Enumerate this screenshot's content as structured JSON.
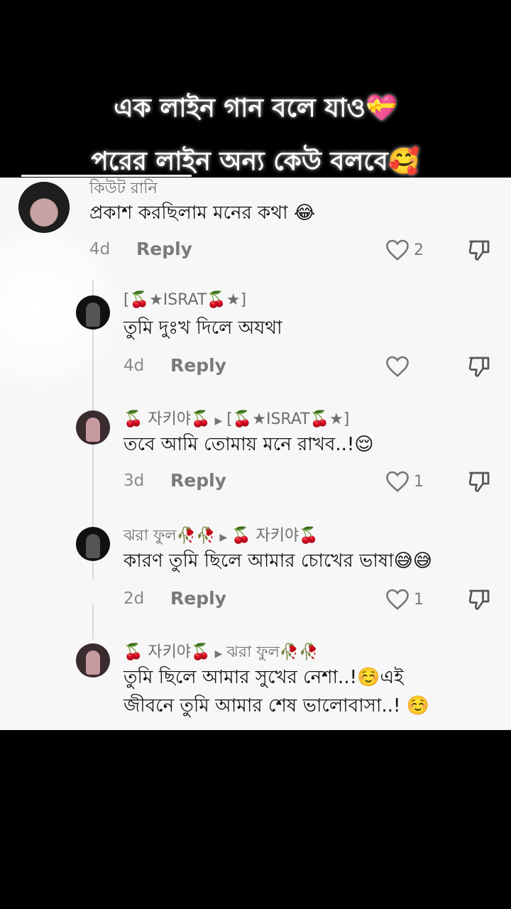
{
  "caption": {
    "line1": "এক লাইন গান বলে যাও💝",
    "line2": "পরের লাইন অন্য কেউ বলবে🥰"
  },
  "comments": [
    {
      "username": "কিউট রানি",
      "text": "প্রকাশ করছিলাম মনের কথা 😂",
      "age": "4d",
      "reply": "Reply",
      "likes": "2"
    },
    {
      "username": "[🍒★ISRAT🍒★]",
      "text": "তুমি দুঃখ দিলে অযথা",
      "age": "4d",
      "reply": "Reply",
      "likes": ""
    },
    {
      "username": "🍒 자키야🍒",
      "reply_to": "[🍒★ISRAT🍒★]",
      "text": "তবে আমি তোমায় মনে রাখব..!😌",
      "age": "3d",
      "reply": "Reply",
      "likes": "1"
    },
    {
      "username": "ঝরা ফুল🥀🥀",
      "reply_to": "🍒 자키야🍒",
      "text": "কারণ তুমি ছিলে আমার চোখের ভাষা😅😅",
      "age": "2d",
      "reply": "Reply",
      "likes": "1"
    },
    {
      "username": "🍒 자키야🍒",
      "reply_to": "ঝরা ফুল🥀🥀",
      "text_line1": "তুমি ছিলে আমার সুখের নেশা..!☺️এই",
      "text_line2": "জীবনে তুমি আমার শেষ ভালোবাসা..! ☺️"
    }
  ],
  "icons": {
    "like": "heart-outline-icon",
    "dislike": "thumbs-down-outline-icon",
    "reply_arrow": "triangle-right-icon"
  },
  "colors": {
    "panel_bg": "#f7f7f7",
    "text": "#111111",
    "muted": "#8a8a8a"
  }
}
